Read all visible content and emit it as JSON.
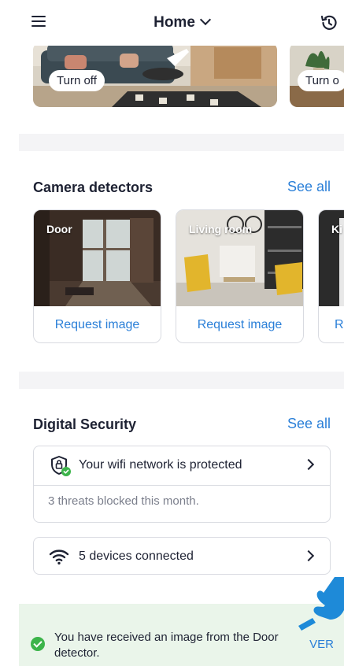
{
  "header": {
    "title": "Home",
    "menu_icon": "hamburger-menu-icon",
    "history_icon": "history-icon"
  },
  "scenes": [
    {
      "action_label": "Turn off"
    },
    {
      "action_label": "Turn o"
    }
  ],
  "cameras": {
    "title": "Camera detectors",
    "see_all": "See all",
    "items": [
      {
        "name": "Door",
        "action": "Request image"
      },
      {
        "name": "Living room",
        "action": "Request image"
      },
      {
        "name": "Ki",
        "action": "R"
      }
    ]
  },
  "security": {
    "title": "Digital Security",
    "see_all": "See all",
    "wifi": {
      "label": "Your wifi network is protected",
      "detail": "3 threats blocked this month.",
      "icon": "shield-lock-icon"
    },
    "devices": {
      "label": "5 devices connected",
      "icon": "wifi-icon"
    }
  },
  "toast": {
    "message": "You have received an image from the Door detector.",
    "action": "VER"
  },
  "colors": {
    "accent": "#2a7fd8",
    "text": "#1e2233",
    "success": "#3cb44a",
    "toast_bg": "#eaf5ea",
    "section_band": "#f4f4f6"
  }
}
